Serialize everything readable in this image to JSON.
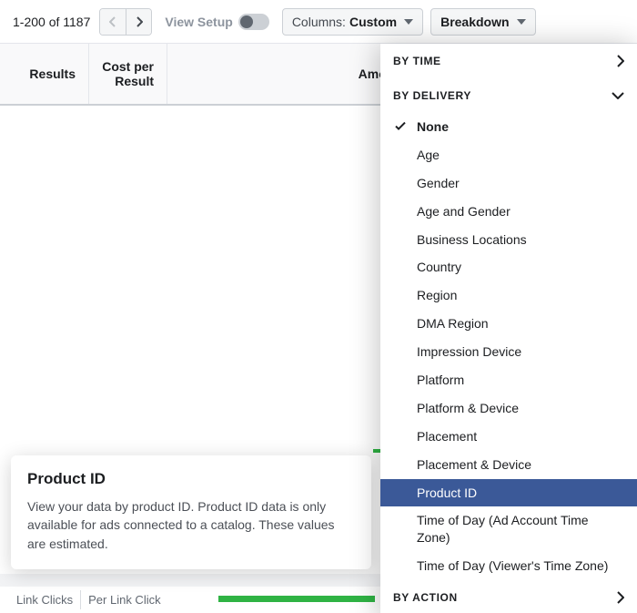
{
  "toolbar": {
    "pagination": "1-200 of 1187",
    "view_setup_label": "View Setup",
    "columns_label": "Columns:",
    "columns_value": "Custom",
    "breakdown_label": "Breakdown"
  },
  "headers": {
    "results": "Results",
    "cost_per_result": "Cost per Result",
    "amount_spent": "Amount Spent"
  },
  "tooltip": {
    "title": "Product ID",
    "body": "View your data by product ID. Product ID data is only available for ads connected to a catalog. These values are estimated."
  },
  "footer": {
    "link_clicks": "Link Clicks",
    "per_link_click": "Per Link Click"
  },
  "dropdown": {
    "sections": {
      "by_time": "BY TIME",
      "by_delivery": "BY DELIVERY",
      "by_action": "BY ACTION"
    },
    "selected": "None",
    "highlighted": "Product ID",
    "delivery_options": [
      "None",
      "Age",
      "Gender",
      "Age and Gender",
      "Business Locations",
      "Country",
      "Region",
      "DMA Region",
      "Impression Device",
      "Platform",
      "Platform & Device",
      "Placement",
      "Placement & Device",
      "Product ID",
      "Time of Day (Ad Account Time Zone)",
      "Time of Day (Viewer's Time Zone)"
    ]
  }
}
